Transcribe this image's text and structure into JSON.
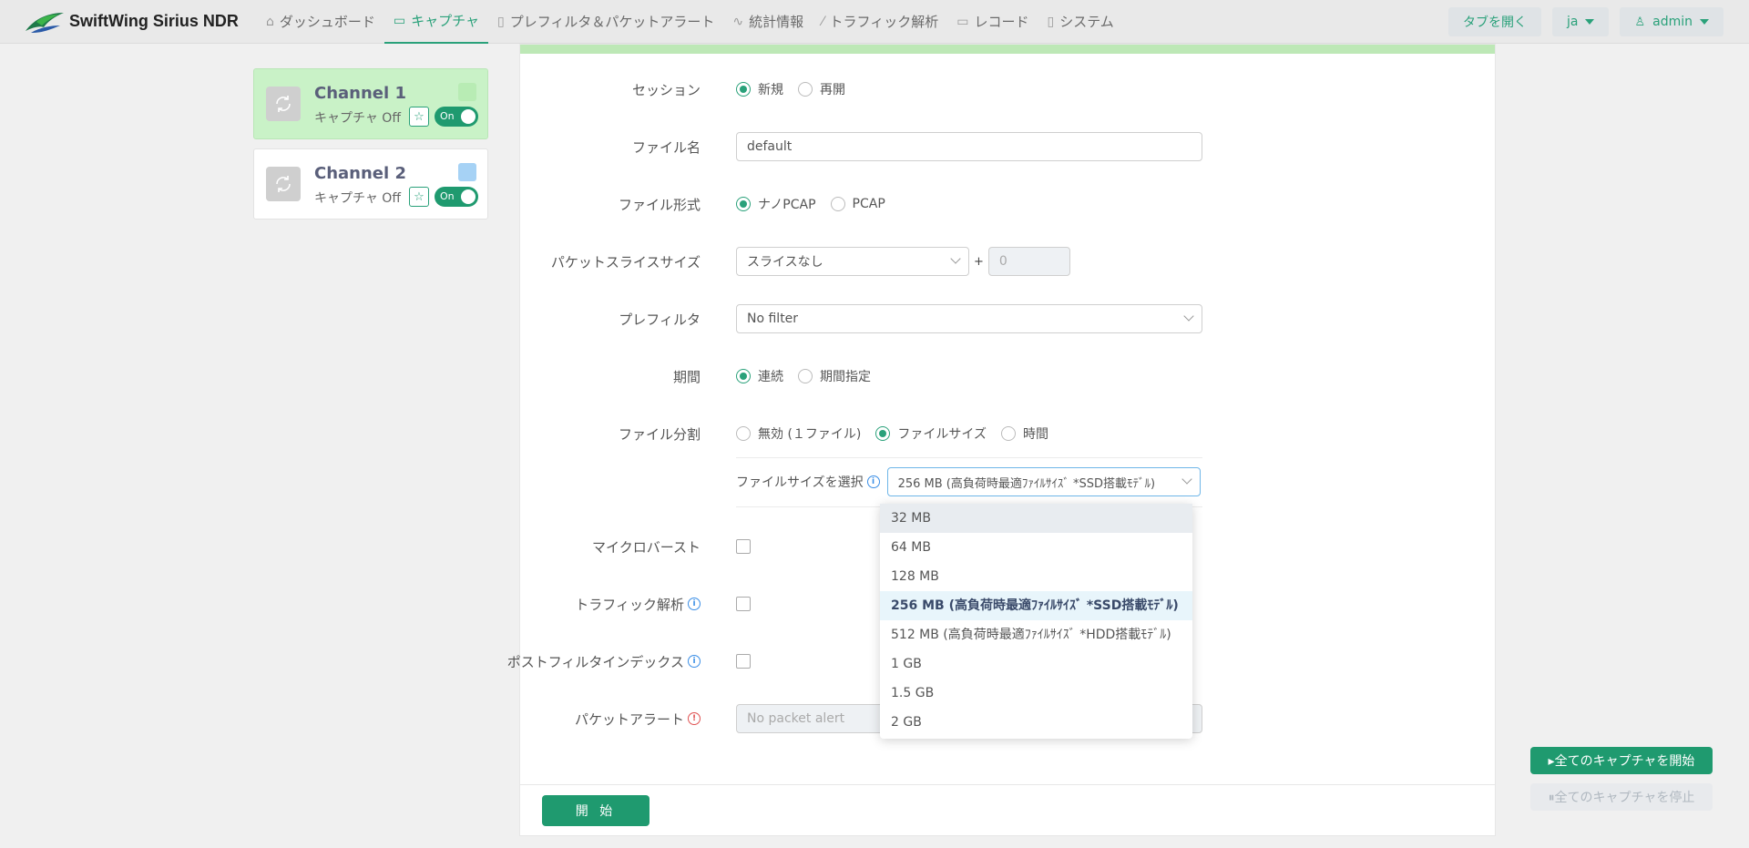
{
  "app": {
    "title": "SwiftWing Sirius NDR"
  },
  "nav": [
    {
      "label": "ダッシュボード",
      "icon": "home-icon",
      "active": false
    },
    {
      "label": "キャプチャ",
      "icon": "video-icon",
      "active": true
    },
    {
      "label": "プレフィルタ＆パケットアラート",
      "icon": "clipboard-icon",
      "active": false
    },
    {
      "label": "統計情報",
      "icon": "pulse-icon",
      "active": false
    },
    {
      "label": "トラフィック解析",
      "icon": "wand-icon",
      "active": false
    },
    {
      "label": "レコード",
      "icon": "folder-icon",
      "active": false
    },
    {
      "label": "システム",
      "icon": "clipboard-icon",
      "active": false
    }
  ],
  "header_right": {
    "open_tab": "タブを開く",
    "lang": "ja",
    "user": "admin"
  },
  "channels": [
    {
      "name": "Channel 1",
      "status": "キャプチャ Off",
      "toggle": "On",
      "color": "#b8ecb4",
      "selected": true
    },
    {
      "name": "Channel 2",
      "status": "キャプチャ Off",
      "toggle": "On",
      "color": "#a6d2f5",
      "selected": false
    }
  ],
  "form": {
    "session": {
      "label": "セッション",
      "options": [
        "新規",
        "再開"
      ],
      "selected": 0
    },
    "filename": {
      "label": "ファイル名",
      "value": "default"
    },
    "format": {
      "label": "ファイル形式",
      "options": [
        "ナノPCAP",
        "PCAP"
      ],
      "selected": 0
    },
    "slice": {
      "label": "パケットスライスサイズ",
      "value": "スライスなし",
      "plus": "+",
      "extra": "0"
    },
    "prefilter": {
      "label": "プレフィルタ",
      "value": "No filter"
    },
    "period": {
      "label": "期間",
      "options": [
        "連続",
        "期間指定"
      ],
      "selected": 0
    },
    "split": {
      "label": "ファイル分割",
      "options": [
        "無効 (１ファイル)",
        "ファイルサイズ",
        "時間"
      ],
      "selected": 1
    },
    "filesize": {
      "label": "ファイルサイズを選択",
      "value": "256 MB (高負荷時最適ﾌｧｲﾙｻｲｽﾞ *SSD搭載ﾓﾃﾞﾙ)"
    },
    "microburst": {
      "label": "マイクロバースト"
    },
    "traffic": {
      "label": "トラフィック解析"
    },
    "postfilter": {
      "label": "ポストフィルタインデックス"
    },
    "packet_alert": {
      "label": "パケットアラート",
      "placeholder": "No packet alert"
    }
  },
  "dropdown": {
    "items": [
      "32 MB",
      "64 MB",
      "128 MB",
      "256 MB (高負荷時最適ﾌｧｲﾙｻｲｽﾞ *SSD搭載ﾓﾃﾞﾙ)",
      "512 MB (高負荷時最適ﾌｧｲﾙｻｲｽﾞ *HDD搭載ﾓﾃﾞﾙ)",
      "1 GB",
      "1.5 GB",
      "2 GB"
    ],
    "hover": 0,
    "selected": 3
  },
  "buttons": {
    "start": "開 始",
    "start_all": "▸全てのキャプチャを開始",
    "stop_all": "⏸全てのキャプチャを停止"
  },
  "colors": {
    "accent": "#1f9a6f",
    "selected_channel": "#c9f2c7"
  }
}
